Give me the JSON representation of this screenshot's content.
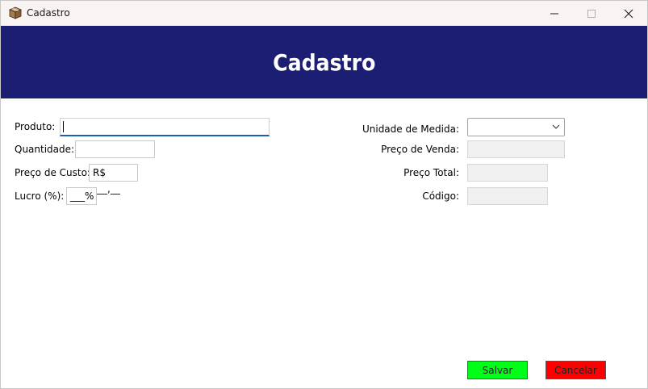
{
  "window": {
    "title": "Cadastro",
    "minimize_icon": "minimize-icon",
    "maximize_icon": "maximize-icon",
    "close_icon": "close-icon"
  },
  "header": {
    "title": "Cadastro"
  },
  "form": {
    "produto": {
      "label": "Produto:",
      "value": ""
    },
    "quantidade": {
      "label": "Quantidade:",
      "value": ""
    },
    "preco_custo": {
      "label": "Preço de Custo:",
      "value": "R$ ___,__"
    },
    "lucro": {
      "label": "Lucro (%):",
      "value": "___%"
    },
    "unidade_medida": {
      "label": "Unidade de Medida:",
      "value": ""
    },
    "preco_venda": {
      "label": "Preço de Venda:",
      "value": ""
    },
    "preco_total": {
      "label": "Preço Total:",
      "value": ""
    },
    "codigo": {
      "label": "Código:",
      "value": ""
    }
  },
  "buttons": {
    "save_label": "Salvar",
    "cancel_label": "Cancelar"
  },
  "colors": {
    "header_bg": "#1b1e73",
    "save_bg": "#00ff18",
    "cancel_bg": "#ff0000",
    "focus_accent": "#1a5fb4"
  }
}
